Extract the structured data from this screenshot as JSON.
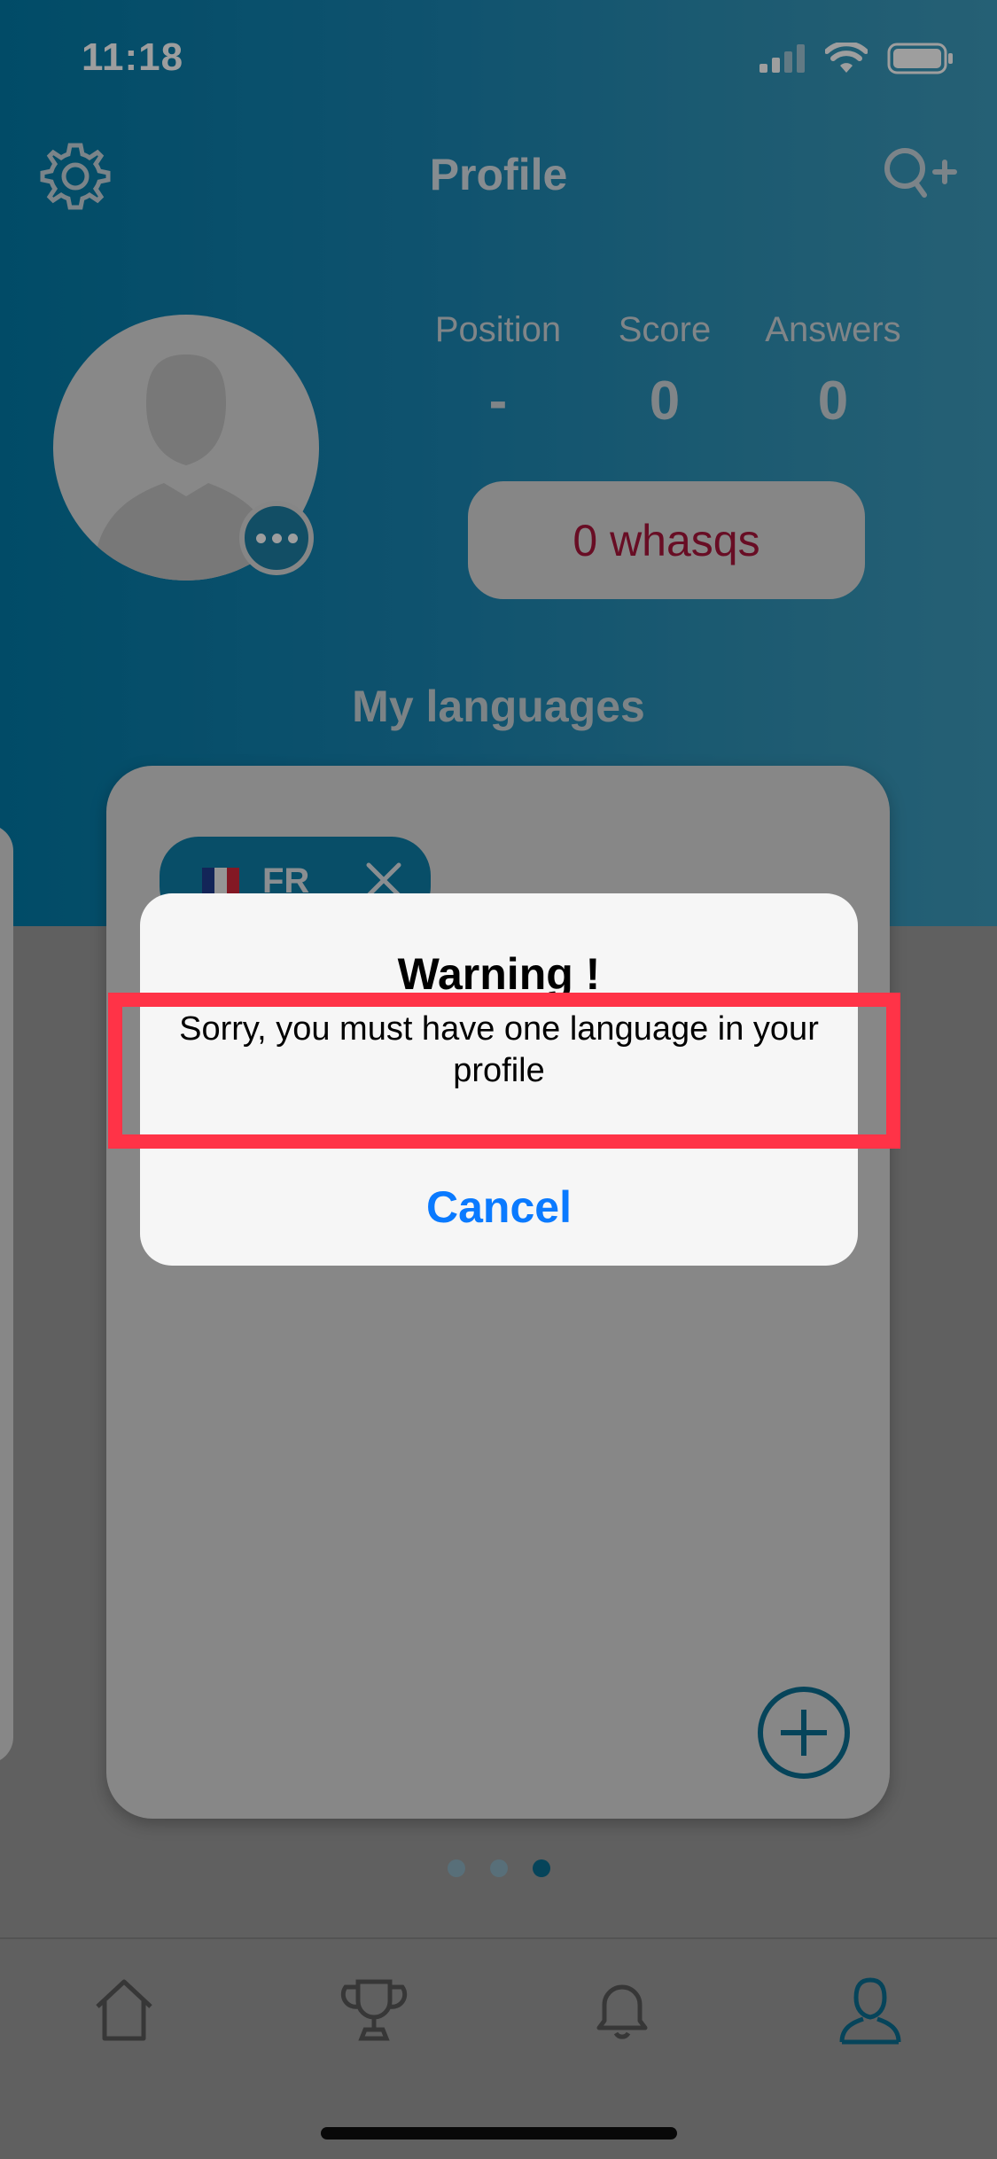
{
  "status_bar": {
    "time": "11:18"
  },
  "header": {
    "title": "Profile",
    "settings_icon": "gear-icon",
    "search_add_icon": "search-plus-icon"
  },
  "stats": {
    "position": {
      "label": "Position",
      "value": "-"
    },
    "score": {
      "label": "Score",
      "value": "0"
    },
    "answers": {
      "label": "Answers",
      "value": "0"
    }
  },
  "whasqs": {
    "label": "0 whasqs"
  },
  "languages": {
    "title": "My languages",
    "items": [
      {
        "code": "FR",
        "flag": "french-flag-icon"
      }
    ]
  },
  "pager": {
    "count": 3,
    "active_index": 2
  },
  "tabbar": {
    "items": [
      "home-icon",
      "trophy-icon",
      "bell-icon",
      "profile-icon"
    ],
    "active": "profile-icon"
  },
  "alert": {
    "title": "Warning !",
    "message": "Sorry, you must have one language in your profile",
    "cancel_label": "Cancel"
  },
  "colors": {
    "accent": "#0a6f91",
    "alert_button": "#0a7aff",
    "highlight": "#ff3347",
    "whasqs_text": "#a8153b"
  }
}
